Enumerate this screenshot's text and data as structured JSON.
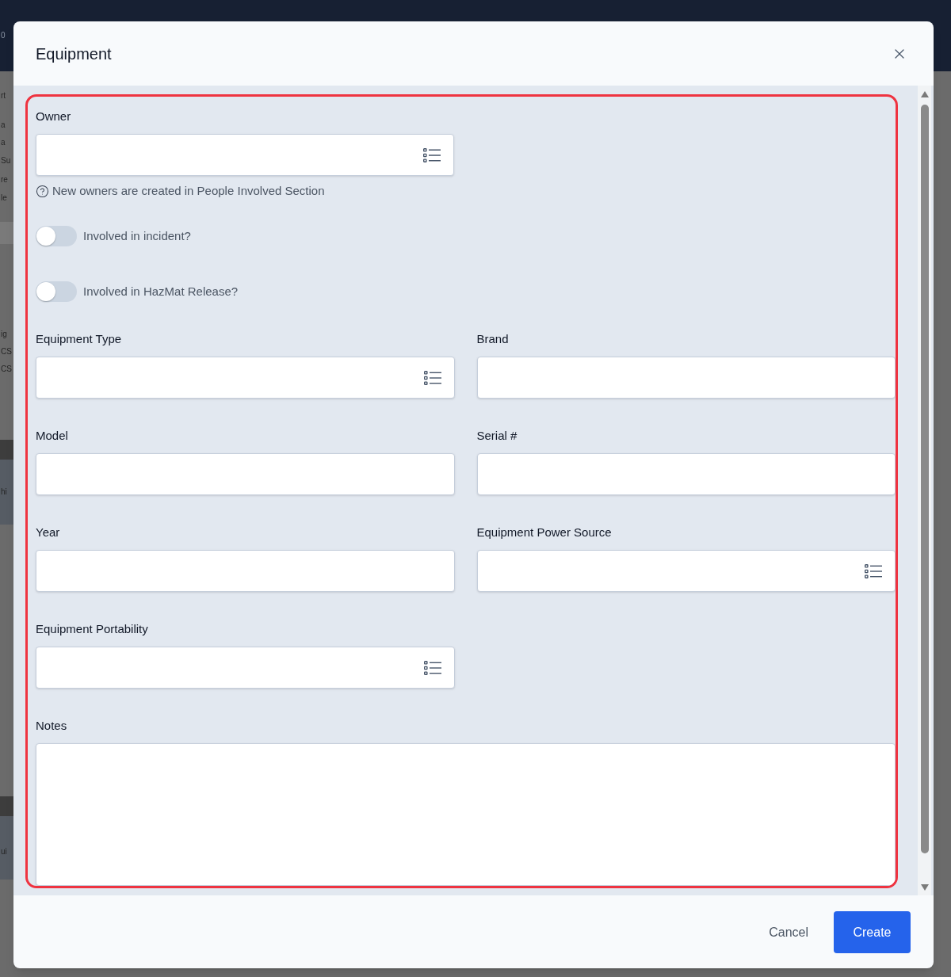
{
  "background_fragments": [
    "0",
    "rt",
    "a",
    "a",
    "Su",
    "re",
    "le",
    "ig",
    "CS",
    "CS",
    "hi",
    "ui"
  ],
  "dialog": {
    "title": "Equipment"
  },
  "owner": {
    "label": "Owner",
    "kind": "select",
    "hint": "New owners are created in People Involved Section"
  },
  "toggles": [
    {
      "label": "Involved in incident?",
      "on": false
    },
    {
      "label": "Involved in HazMat Release?",
      "on": false
    }
  ],
  "fields": [
    {
      "label": "Equipment Type",
      "kind": "select"
    },
    {
      "label": "Brand",
      "kind": "text"
    },
    {
      "label": "Model",
      "kind": "text"
    },
    {
      "label": "Serial #",
      "kind": "text"
    },
    {
      "label": "Year",
      "kind": "text"
    },
    {
      "label": "Equipment Power Source",
      "kind": "select"
    },
    {
      "label": "Equipment Portability",
      "kind": "select"
    }
  ],
  "notes": {
    "label": "Notes"
  },
  "buttons": [
    {
      "label": "Cancel",
      "kind": "secondary"
    },
    {
      "label": "Create",
      "kind": "primary"
    }
  ]
}
